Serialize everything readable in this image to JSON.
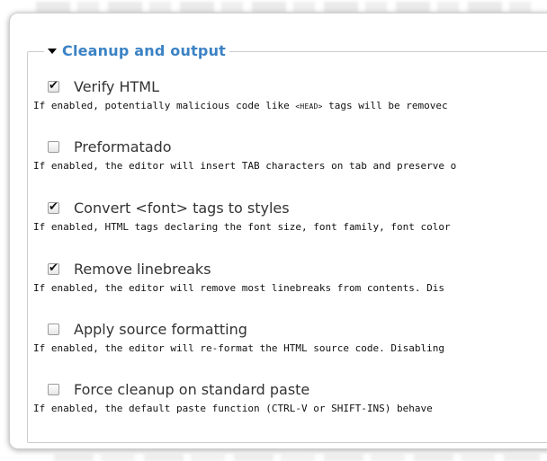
{
  "fieldset": {
    "legend": "Cleanup and output"
  },
  "options": [
    {
      "label": "Verify HTML",
      "checked": true,
      "desc_pre": "If enabled, potentially malicious code like ",
      "desc_tag": "<HEAD>",
      "desc_post": " tags will be removec"
    },
    {
      "label": "Preformatado",
      "checked": false,
      "desc": "If enabled, the editor will insert TAB characters on tab and preserve o"
    },
    {
      "label": "Convert <font> tags to styles",
      "checked": true,
      "desc": "If enabled, HTML tags declaring the font size, font family, font color"
    },
    {
      "label": "Remove linebreaks",
      "checked": true,
      "desc": "If enabled, the editor will remove most linebreaks from contents. Dis"
    },
    {
      "label": "Apply source formatting",
      "checked": false,
      "desc": "If enabled, the editor will re-format the HTML source code. Disabling"
    },
    {
      "label": "Force cleanup on standard paste",
      "checked": false,
      "desc": "If enabled, the default paste function (CTRL-V or SHIFT-INS) behave"
    }
  ],
  "icons": {
    "collapse": "triangle-down-icon",
    "checkbox_checked": "checkmark-icon"
  },
  "colors": {
    "legend": "#3b82c4",
    "label": "#333333",
    "description": "#111111",
    "border": "#cccccc"
  }
}
